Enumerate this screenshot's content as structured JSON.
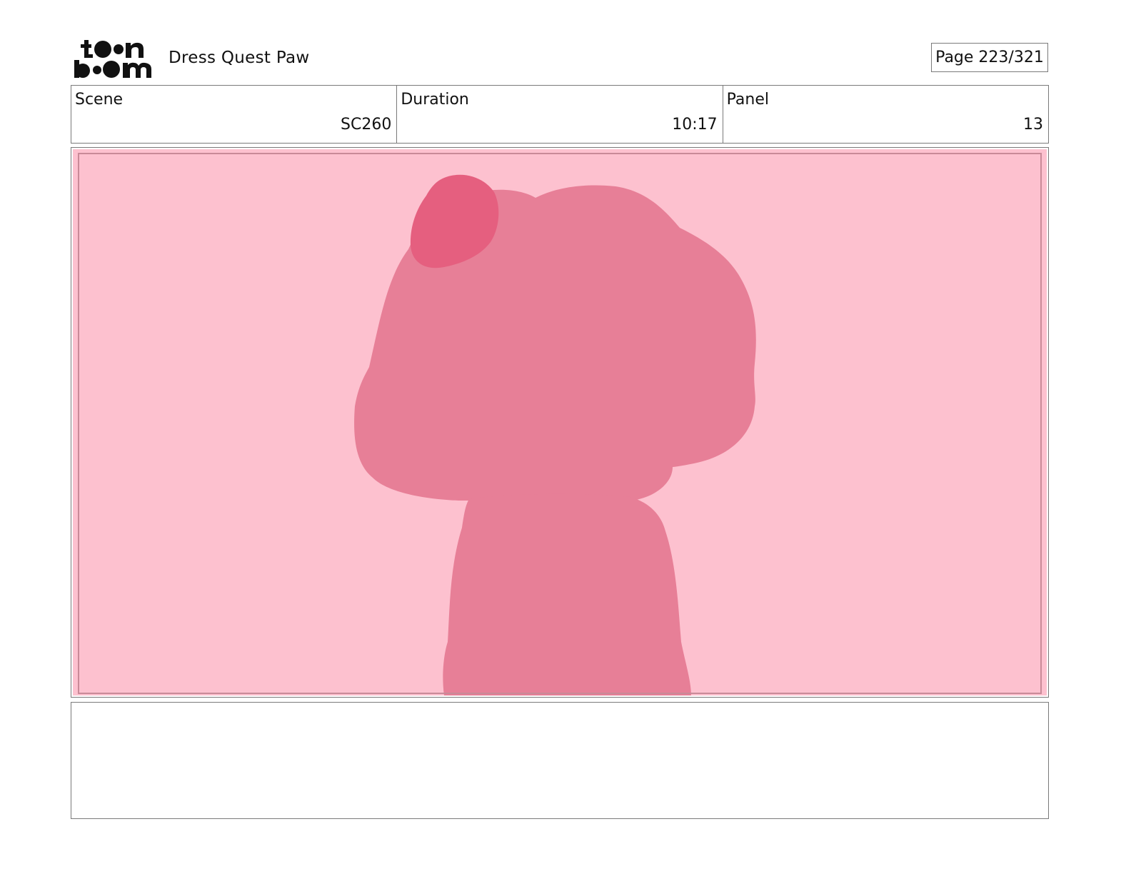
{
  "header": {
    "logo_line1": "toon",
    "logo_line2": "boom",
    "project_title": "Dress Quest Paw",
    "page_indicator": "Page 223/321"
  },
  "info": {
    "scene_label": "Scene",
    "scene_value": "SC260",
    "duration_label": "Duration",
    "duration_value": "10:17",
    "panel_label": "Panel",
    "panel_value": "13"
  },
  "panel": {
    "background_color": "#fdc1cf",
    "safe_frame_color": "#c98a98",
    "figure_color": "#e77f97",
    "hair_bow_color": "#e55f7f"
  },
  "notes": {
    "text": ""
  }
}
